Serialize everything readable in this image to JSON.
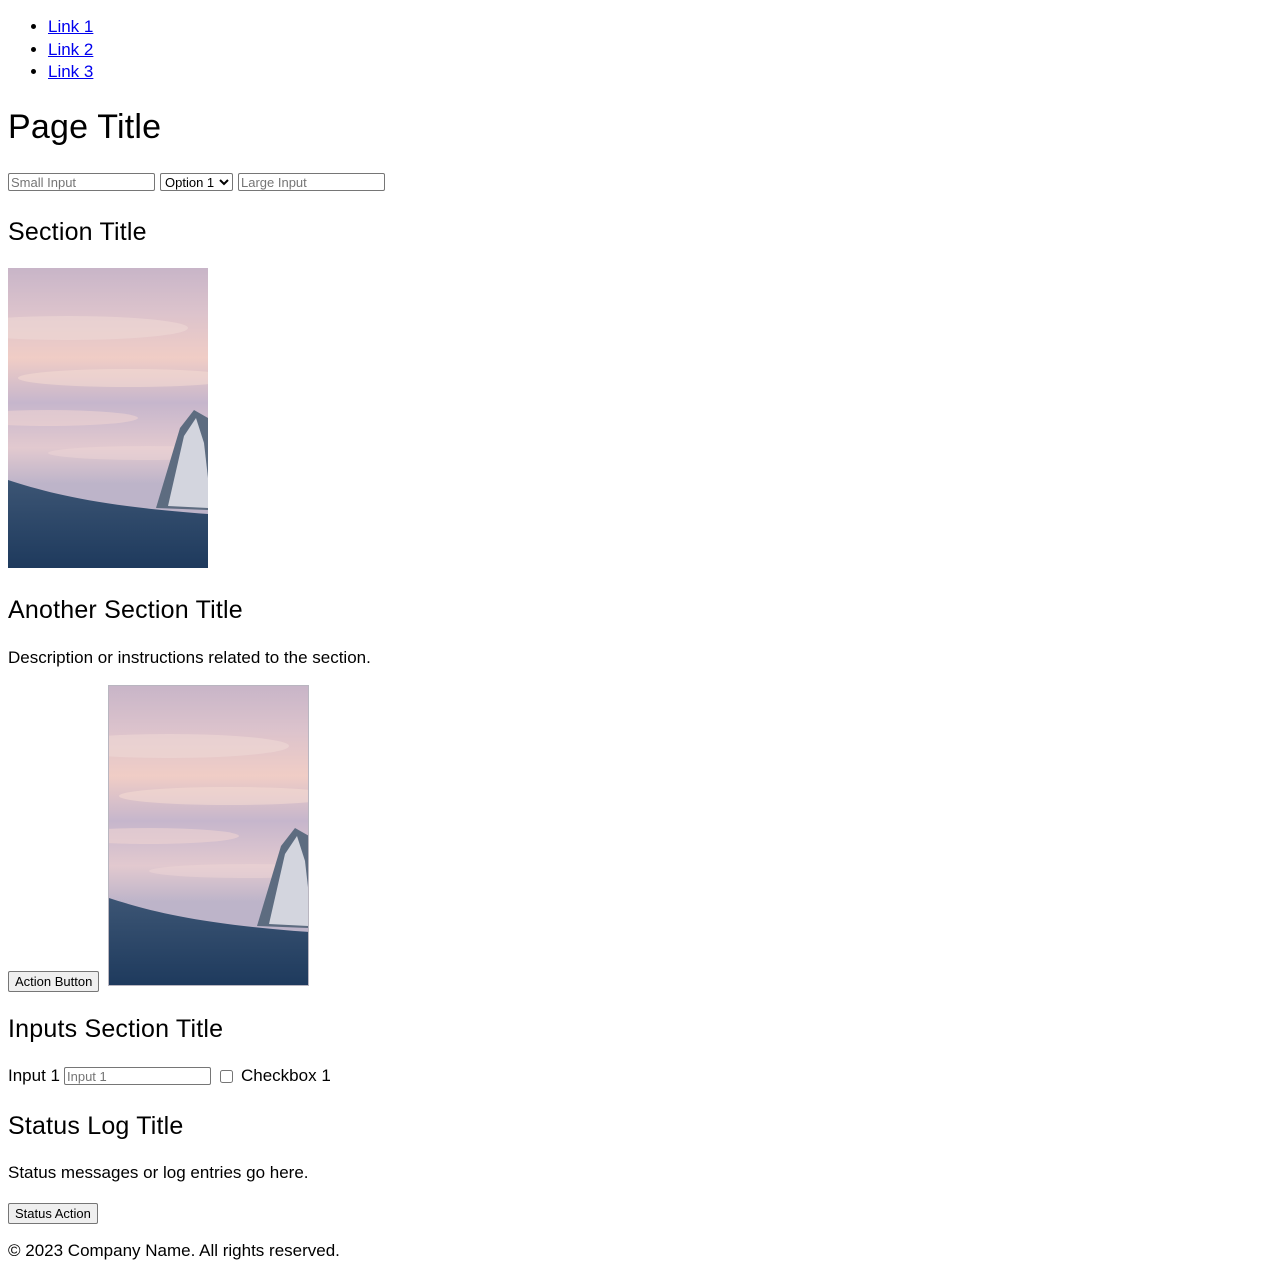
{
  "nav": {
    "links": [
      "Link 1",
      "Link 2",
      "Link 3"
    ]
  },
  "header": {
    "title": "Page Title"
  },
  "form": {
    "small_input_placeholder": "Small Input",
    "select_value": "Option 1",
    "large_input_placeholder": "Large Input"
  },
  "section1": {
    "title": "Section Title"
  },
  "section2": {
    "title": "Another Section Title",
    "description": "Description or instructions related to the section.",
    "action_button": "Action Button"
  },
  "inputs_section": {
    "title": "Inputs Section Title",
    "input_label": "Input 1",
    "input_placeholder": "Input 1",
    "checkbox_label": "Checkbox 1"
  },
  "status_section": {
    "title": "Status Log Title",
    "message": "Status messages or log entries go here.",
    "button": "Status Action"
  },
  "footer": {
    "text": "© 2023 Company Name. All rights reserved."
  }
}
